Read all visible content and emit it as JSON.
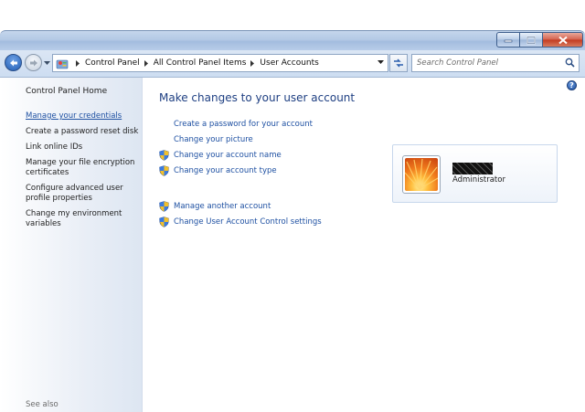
{
  "window": {
    "address": {
      "crumbs": [
        "Control Panel",
        "All Control Panel Items",
        "User Accounts"
      ]
    },
    "search": {
      "placeholder": "Search Control Panel"
    }
  },
  "sidebar": {
    "home": "Control Panel Home",
    "links": [
      "Manage your credentials",
      "Create a password reset disk",
      "Link online IDs",
      "Manage your file encryption certificates",
      "Configure advanced user profile properties",
      "Change my environment variables"
    ],
    "see_also": "See also"
  },
  "main": {
    "heading": "Make changes to your user account",
    "tasks": [
      {
        "label": "Create a password for your account",
        "icon": "none"
      },
      {
        "label": "Change your picture",
        "icon": "none"
      },
      {
        "label": "Change your account name",
        "icon": "uac-shield-icon"
      },
      {
        "label": "Change your account type",
        "icon": "uac-shield-icon"
      },
      {
        "label": "Manage another account",
        "icon": "uac-shield-icon"
      },
      {
        "label": "Change User Account Control settings",
        "icon": "uac-shield-icon"
      }
    ],
    "account": {
      "role": "Administrator"
    }
  },
  "colors": {
    "link": "#1e50a2",
    "heading": "#1e3f82",
    "close_button": "#c2391f"
  }
}
